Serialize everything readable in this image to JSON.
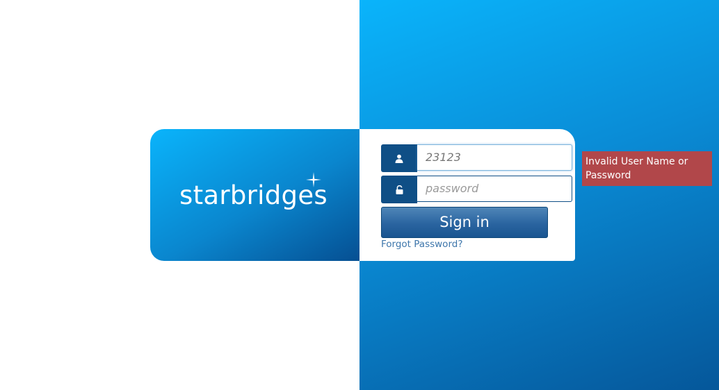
{
  "brand": {
    "logo_text": "starbridges",
    "icon": "star-sparkle-icon"
  },
  "login": {
    "username_value": "23123",
    "username_icon": "user-icon",
    "password_placeholder": "password",
    "password_icon": "unlock-icon",
    "signin_label": "Sign in",
    "forgot_label": "Forgot Password?"
  },
  "error": {
    "message": "Invalid User Name or Password"
  },
  "colors": {
    "accent": "#0f4f86",
    "gradient_start": "#0ab4fb",
    "gradient_end": "#05579a",
    "error_bg": "#b1474a",
    "link": "#3d76ab"
  }
}
